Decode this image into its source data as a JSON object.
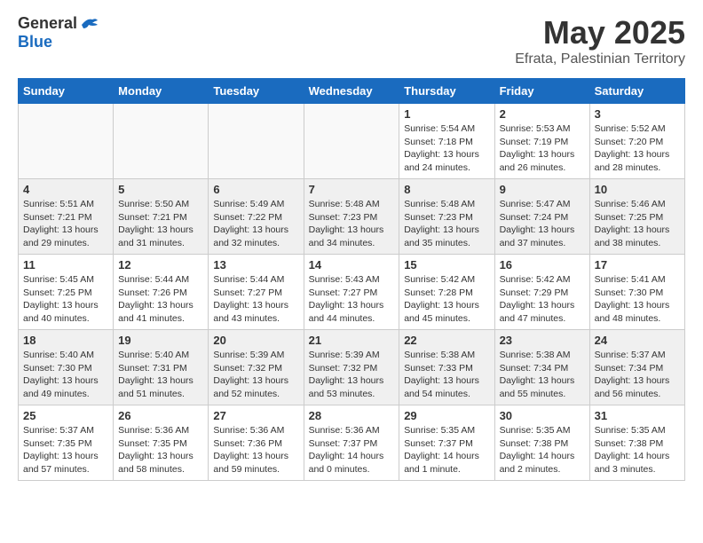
{
  "header": {
    "logo_general": "General",
    "logo_blue": "Blue",
    "month_title": "May 2025",
    "location": "Efrata, Palestinian Territory"
  },
  "weekdays": [
    "Sunday",
    "Monday",
    "Tuesday",
    "Wednesday",
    "Thursday",
    "Friday",
    "Saturday"
  ],
  "weeks": [
    [
      {
        "day": "",
        "info": ""
      },
      {
        "day": "",
        "info": ""
      },
      {
        "day": "",
        "info": ""
      },
      {
        "day": "",
        "info": ""
      },
      {
        "day": "1",
        "info": "Sunrise: 5:54 AM\nSunset: 7:18 PM\nDaylight: 13 hours\nand 24 minutes."
      },
      {
        "day": "2",
        "info": "Sunrise: 5:53 AM\nSunset: 7:19 PM\nDaylight: 13 hours\nand 26 minutes."
      },
      {
        "day": "3",
        "info": "Sunrise: 5:52 AM\nSunset: 7:20 PM\nDaylight: 13 hours\nand 28 minutes."
      }
    ],
    [
      {
        "day": "4",
        "info": "Sunrise: 5:51 AM\nSunset: 7:21 PM\nDaylight: 13 hours\nand 29 minutes."
      },
      {
        "day": "5",
        "info": "Sunrise: 5:50 AM\nSunset: 7:21 PM\nDaylight: 13 hours\nand 31 minutes."
      },
      {
        "day": "6",
        "info": "Sunrise: 5:49 AM\nSunset: 7:22 PM\nDaylight: 13 hours\nand 32 minutes."
      },
      {
        "day": "7",
        "info": "Sunrise: 5:48 AM\nSunset: 7:23 PM\nDaylight: 13 hours\nand 34 minutes."
      },
      {
        "day": "8",
        "info": "Sunrise: 5:48 AM\nSunset: 7:23 PM\nDaylight: 13 hours\nand 35 minutes."
      },
      {
        "day": "9",
        "info": "Sunrise: 5:47 AM\nSunset: 7:24 PM\nDaylight: 13 hours\nand 37 minutes."
      },
      {
        "day": "10",
        "info": "Sunrise: 5:46 AM\nSunset: 7:25 PM\nDaylight: 13 hours\nand 38 minutes."
      }
    ],
    [
      {
        "day": "11",
        "info": "Sunrise: 5:45 AM\nSunset: 7:25 PM\nDaylight: 13 hours\nand 40 minutes."
      },
      {
        "day": "12",
        "info": "Sunrise: 5:44 AM\nSunset: 7:26 PM\nDaylight: 13 hours\nand 41 minutes."
      },
      {
        "day": "13",
        "info": "Sunrise: 5:44 AM\nSunset: 7:27 PM\nDaylight: 13 hours\nand 43 minutes."
      },
      {
        "day": "14",
        "info": "Sunrise: 5:43 AM\nSunset: 7:27 PM\nDaylight: 13 hours\nand 44 minutes."
      },
      {
        "day": "15",
        "info": "Sunrise: 5:42 AM\nSunset: 7:28 PM\nDaylight: 13 hours\nand 45 minutes."
      },
      {
        "day": "16",
        "info": "Sunrise: 5:42 AM\nSunset: 7:29 PM\nDaylight: 13 hours\nand 47 minutes."
      },
      {
        "day": "17",
        "info": "Sunrise: 5:41 AM\nSunset: 7:30 PM\nDaylight: 13 hours\nand 48 minutes."
      }
    ],
    [
      {
        "day": "18",
        "info": "Sunrise: 5:40 AM\nSunset: 7:30 PM\nDaylight: 13 hours\nand 49 minutes."
      },
      {
        "day": "19",
        "info": "Sunrise: 5:40 AM\nSunset: 7:31 PM\nDaylight: 13 hours\nand 51 minutes."
      },
      {
        "day": "20",
        "info": "Sunrise: 5:39 AM\nSunset: 7:32 PM\nDaylight: 13 hours\nand 52 minutes."
      },
      {
        "day": "21",
        "info": "Sunrise: 5:39 AM\nSunset: 7:32 PM\nDaylight: 13 hours\nand 53 minutes."
      },
      {
        "day": "22",
        "info": "Sunrise: 5:38 AM\nSunset: 7:33 PM\nDaylight: 13 hours\nand 54 minutes."
      },
      {
        "day": "23",
        "info": "Sunrise: 5:38 AM\nSunset: 7:34 PM\nDaylight: 13 hours\nand 55 minutes."
      },
      {
        "day": "24",
        "info": "Sunrise: 5:37 AM\nSunset: 7:34 PM\nDaylight: 13 hours\nand 56 minutes."
      }
    ],
    [
      {
        "day": "25",
        "info": "Sunrise: 5:37 AM\nSunset: 7:35 PM\nDaylight: 13 hours\nand 57 minutes."
      },
      {
        "day": "26",
        "info": "Sunrise: 5:36 AM\nSunset: 7:35 PM\nDaylight: 13 hours\nand 58 minutes."
      },
      {
        "day": "27",
        "info": "Sunrise: 5:36 AM\nSunset: 7:36 PM\nDaylight: 13 hours\nand 59 minutes."
      },
      {
        "day": "28",
        "info": "Sunrise: 5:36 AM\nSunset: 7:37 PM\nDaylight: 14 hours\nand 0 minutes."
      },
      {
        "day": "29",
        "info": "Sunrise: 5:35 AM\nSunset: 7:37 PM\nDaylight: 14 hours\nand 1 minute."
      },
      {
        "day": "30",
        "info": "Sunrise: 5:35 AM\nSunset: 7:38 PM\nDaylight: 14 hours\nand 2 minutes."
      },
      {
        "day": "31",
        "info": "Sunrise: 5:35 AM\nSunset: 7:38 PM\nDaylight: 14 hours\nand 3 minutes."
      }
    ]
  ]
}
